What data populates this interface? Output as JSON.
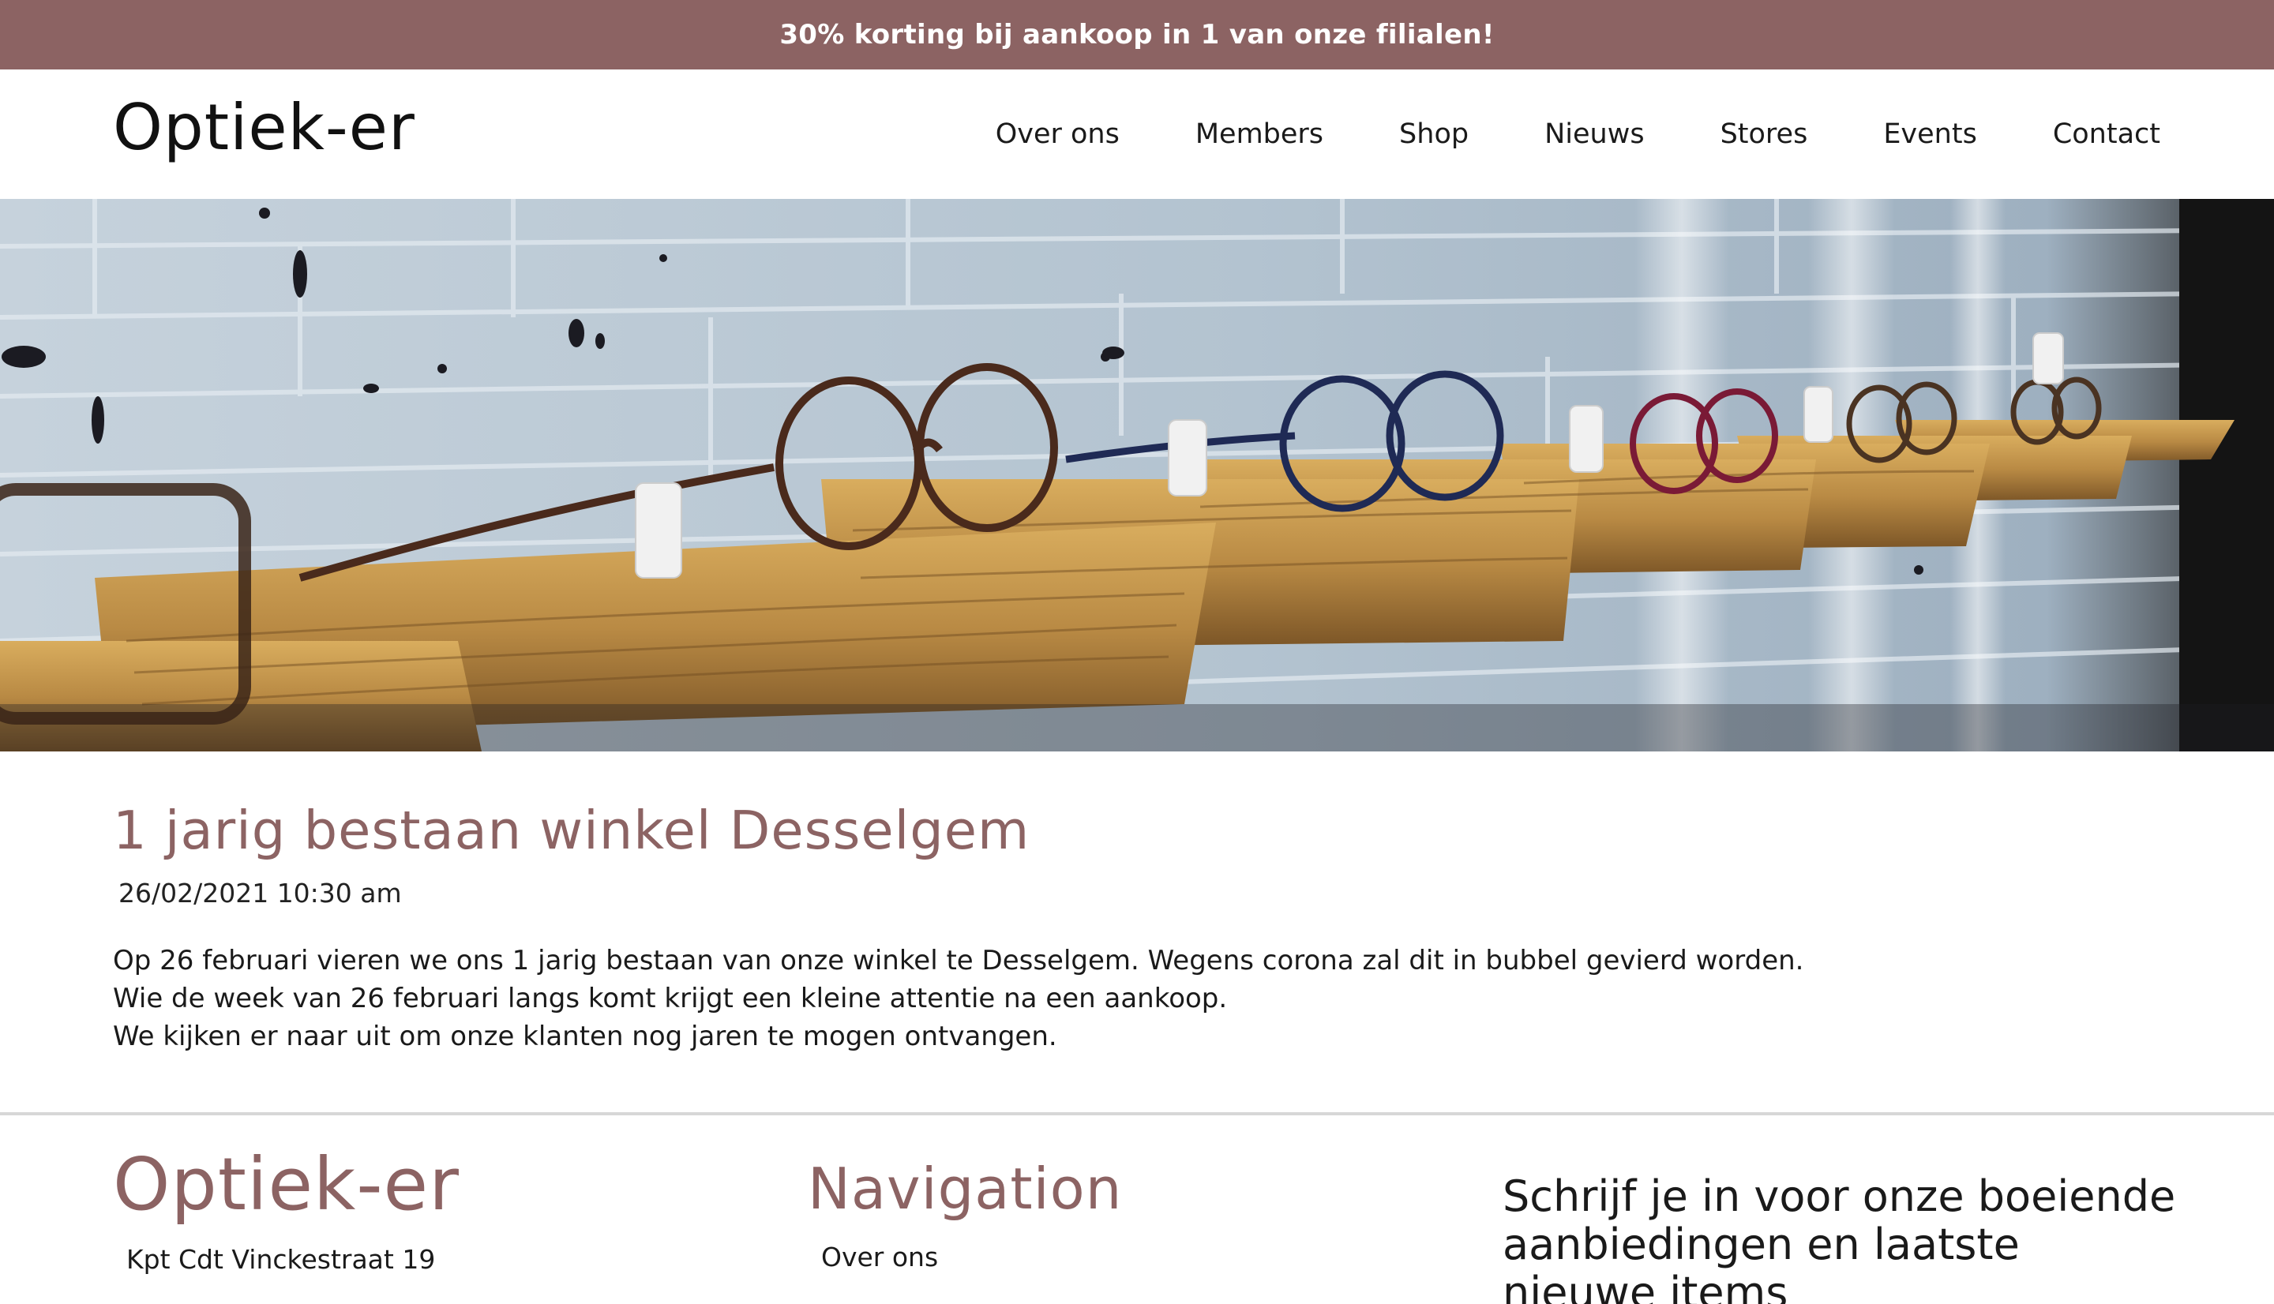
{
  "promo": {
    "text": "30% korting bij aankoop in 1 van onze filialen!"
  },
  "header": {
    "logo": "Optiek-er",
    "nav": [
      {
        "label": "Over ons"
      },
      {
        "label": "Members"
      },
      {
        "label": "Shop"
      },
      {
        "label": "Nieuws"
      },
      {
        "label": "Stores"
      },
      {
        "label": "Events"
      },
      {
        "label": "Contact"
      }
    ]
  },
  "hero": {
    "image": "photo-of-eyeglasses-on-wooden-shelves"
  },
  "article": {
    "title": "1 jarig bestaan winkel Desselgem",
    "date": "26/02/2021 10:30 am",
    "paragraphs": [
      "Op 26 februari vieren we ons 1 jarig bestaan van onze winkel te Desselgem. Wegens corona zal dit in bubbel gevierd worden.",
      "Wie de week van 26 februari langs komt krijgt een kleine attentie na een aankoop.",
      "We kijken er naar uit om onze klanten nog jaren te mogen ontvangen."
    ]
  },
  "footer": {
    "brand": {
      "logo": "Optiek-er",
      "address": "Kpt Cdt Vinckestraat 19"
    },
    "navigation": {
      "title": "Navigation",
      "items": [
        {
          "label": "Over ons"
        }
      ]
    },
    "newsletter": {
      "title": "Schrijf je in voor onze boeiende aanbiedingen en laatste nieuwe items"
    }
  },
  "colors": {
    "accent": "#8c6363",
    "text": "#1a1a1a",
    "background": "#ffffff",
    "divider": "#d7d7d7"
  }
}
